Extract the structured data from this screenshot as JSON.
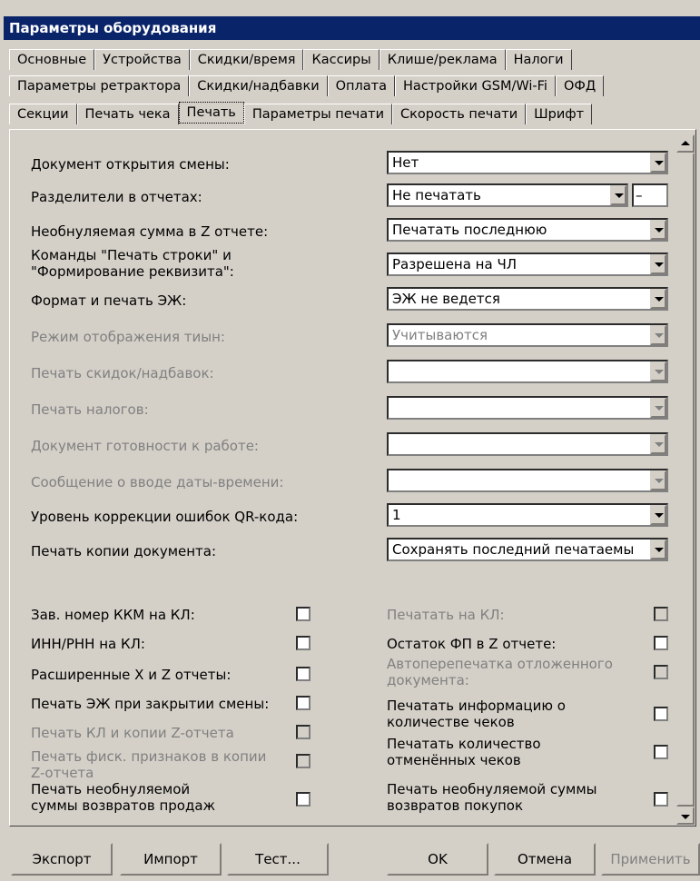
{
  "window": {
    "title": "Параметры оборудования"
  },
  "tabs": {
    "row1": [
      "Основные",
      "Устройства",
      "Скидки/время",
      "Кассиры",
      "Клише/реклама",
      "Налоги"
    ],
    "row2": [
      "Параметры ретрактора",
      "Скидки/надбавки",
      "Оплата",
      "Настройки GSM/Wi-Fi",
      "ОФД"
    ],
    "row3": [
      "Секции",
      "Печать чека",
      "Печать",
      "Параметры печати",
      "Скорость печати",
      "Шрифт"
    ]
  },
  "settings": {
    "doc_open_shift": {
      "label": "Документ открытия смены:",
      "value": "Нет"
    },
    "separators": {
      "label": "Разделители в отчетах:",
      "value": "Не печатать",
      "char": "–"
    },
    "non_null_sum": {
      "label": "Необнуляемая сумма в Z отчете:",
      "value": "Печатать последнюю"
    },
    "commands_line1": "Команды \"Печать строки\" и",
    "commands_line2": "\"Формирование реквизита\":",
    "commands_value": "Разрешена на ЧЛ",
    "ej_format": {
      "label": "Формат и печать ЭЖ:",
      "value": "ЭЖ не ведется"
    },
    "tiyn_mode": {
      "label": "Режим отображения тиын:",
      "value": "Учитываются"
    },
    "discounts_print": {
      "label": "Печать скидок/надбавок:",
      "value": ""
    },
    "taxes_print": {
      "label": "Печать налогов:",
      "value": ""
    },
    "ready_doc": {
      "label": "Документ готовности к работе:",
      "value": ""
    },
    "datetime_msg": {
      "label": "Сообщение о вводе даты-времени:",
      "value": ""
    },
    "qr_level": {
      "label": "Уровень коррекции ошибок QR-кода:",
      "value": "1"
    },
    "copy_doc": {
      "label": "Печать копии документа:",
      "value": "Сохранять последний печатаемы"
    }
  },
  "checkboxes_left": {
    "serial_kl": "Зав. номер ККМ на КЛ:",
    "inn_kl": "ИНН/РНН на КЛ:",
    "ext_xz": "Расширенные X и Z отчеты:",
    "ej_close": "Печать ЭЖ при закрытии смены:",
    "kl_copy_z": "Печать КЛ и копии Z-отчета",
    "fisc_copy_1": "Печать фиск. признаков в копии",
    "fisc_copy_2": "Z-отчета",
    "returns_sales_1": "Печать необнуляемой",
    "returns_sales_2": "суммы возвратов продаж"
  },
  "checkboxes_right": {
    "print_kl": "Печатать на КЛ:",
    "fp_rest": "Остаток ФП в Z отчете:",
    "auto_reprint_1": "Автоперепечатка отложенного",
    "auto_reprint_2": "документа:",
    "receipts_count_1": "Печатать информацию о",
    "receipts_count_2": "количестве чеков",
    "cancelled_count_1": "Печатать количество",
    "cancelled_count_2": "отменённых чеков",
    "returns_purchases_1": "Печать необнуляемой суммы",
    "returns_purchases_2": "возвратов покупок"
  },
  "buttons": {
    "export": "Экспорт",
    "import": "Импорт",
    "test": "Тест...",
    "ok": "OK",
    "cancel": "Отмена",
    "apply": "Применить"
  }
}
